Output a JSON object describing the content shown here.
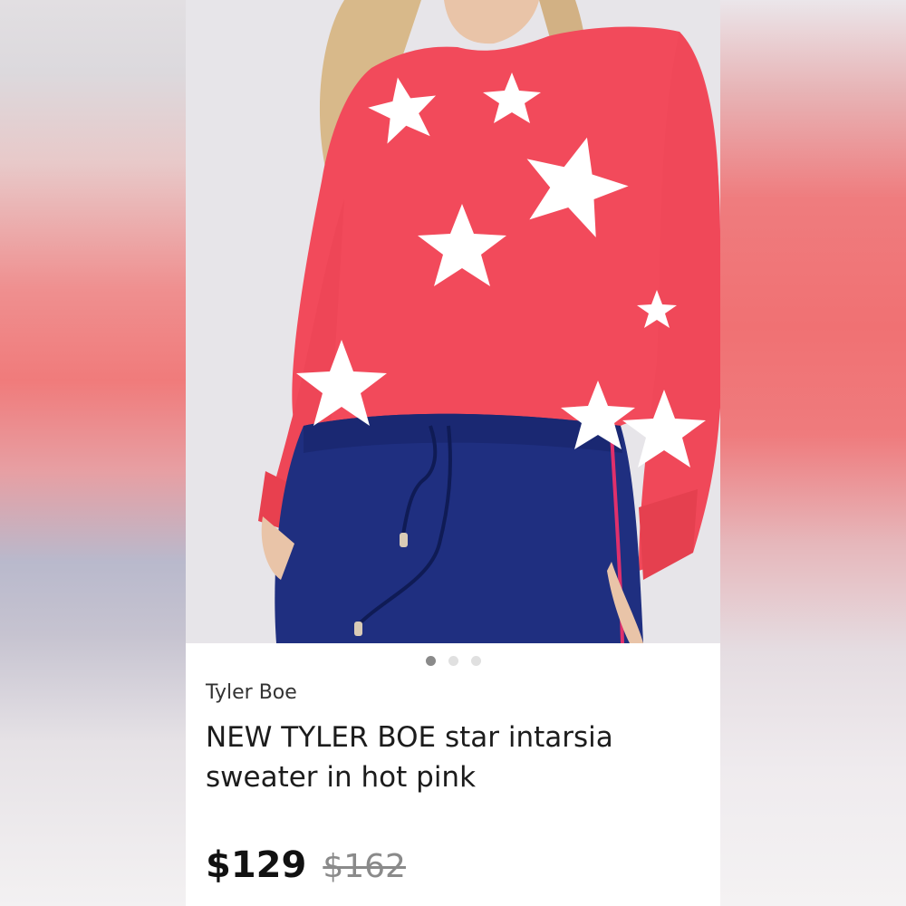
{
  "listing": {
    "brand": "Tyler Boe",
    "title": "NEW TYLER BOE star intarsia sweater in hot pink",
    "price": "$129",
    "original_price": "$162"
  },
  "carousel": {
    "image_count": 3,
    "active_index": 0
  },
  "colors": {
    "sweater": "#f24a5b",
    "pants": "#1f2f80",
    "star": "#ffffff",
    "background": "#e6e4e8"
  }
}
